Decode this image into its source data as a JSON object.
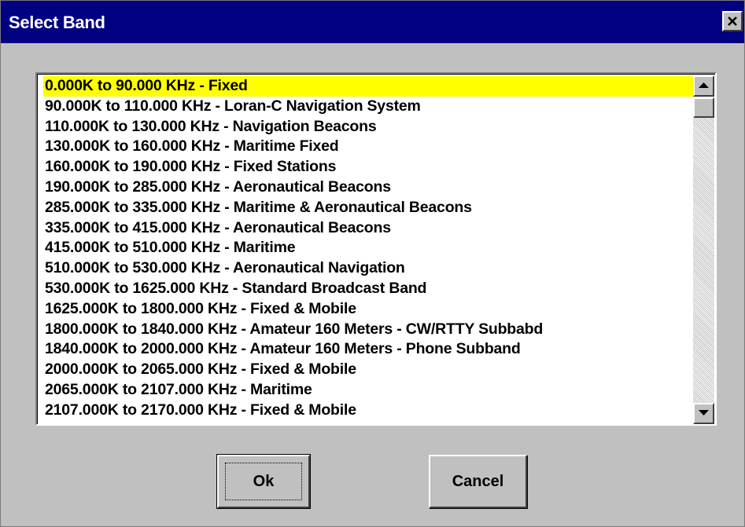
{
  "window": {
    "title": "Select Band"
  },
  "list": {
    "items": [
      "0.000K to 90.000 KHz - Fixed",
      "90.000K to 110.000 KHz - Loran-C Navigation System",
      "110.000K to 130.000 KHz - Navigation Beacons",
      "130.000K to 160.000 KHz - Maritime Fixed",
      "160.000K to 190.000 KHz - Fixed Stations",
      "190.000K to 285.000 KHz - Aeronautical Beacons",
      "285.000K to 335.000 KHz - Maritime & Aeronautical Beacons",
      "335.000K to 415.000 KHz - Aeronautical Beacons",
      "415.000K to 510.000 KHz - Maritime",
      "510.000K to 530.000 KHz - Aeronautical Navigation",
      "530.000K to 1625.000 KHz - Standard Broadcast Band",
      "1625.000K to 1800.000 KHz - Fixed & Mobile",
      "1800.000K to 1840.000 KHz - Amateur 160 Meters - CW/RTTY Subbabd",
      "1840.000K to 2000.000 KHz - Amateur 160 Meters - Phone Subband",
      "2000.000K to 2065.000 KHz - Fixed & Mobile",
      "2065.000K to 2107.000 KHz - Maritime",
      "2107.000K to 2170.000 KHz - Fixed & Mobile"
    ],
    "selected_index": 0
  },
  "buttons": {
    "ok_label": "Ok",
    "cancel_label": "Cancel"
  },
  "colors": {
    "titlebar": "#000080",
    "selection": "#ffff00",
    "dialog_bg": "#c0c0c0"
  }
}
